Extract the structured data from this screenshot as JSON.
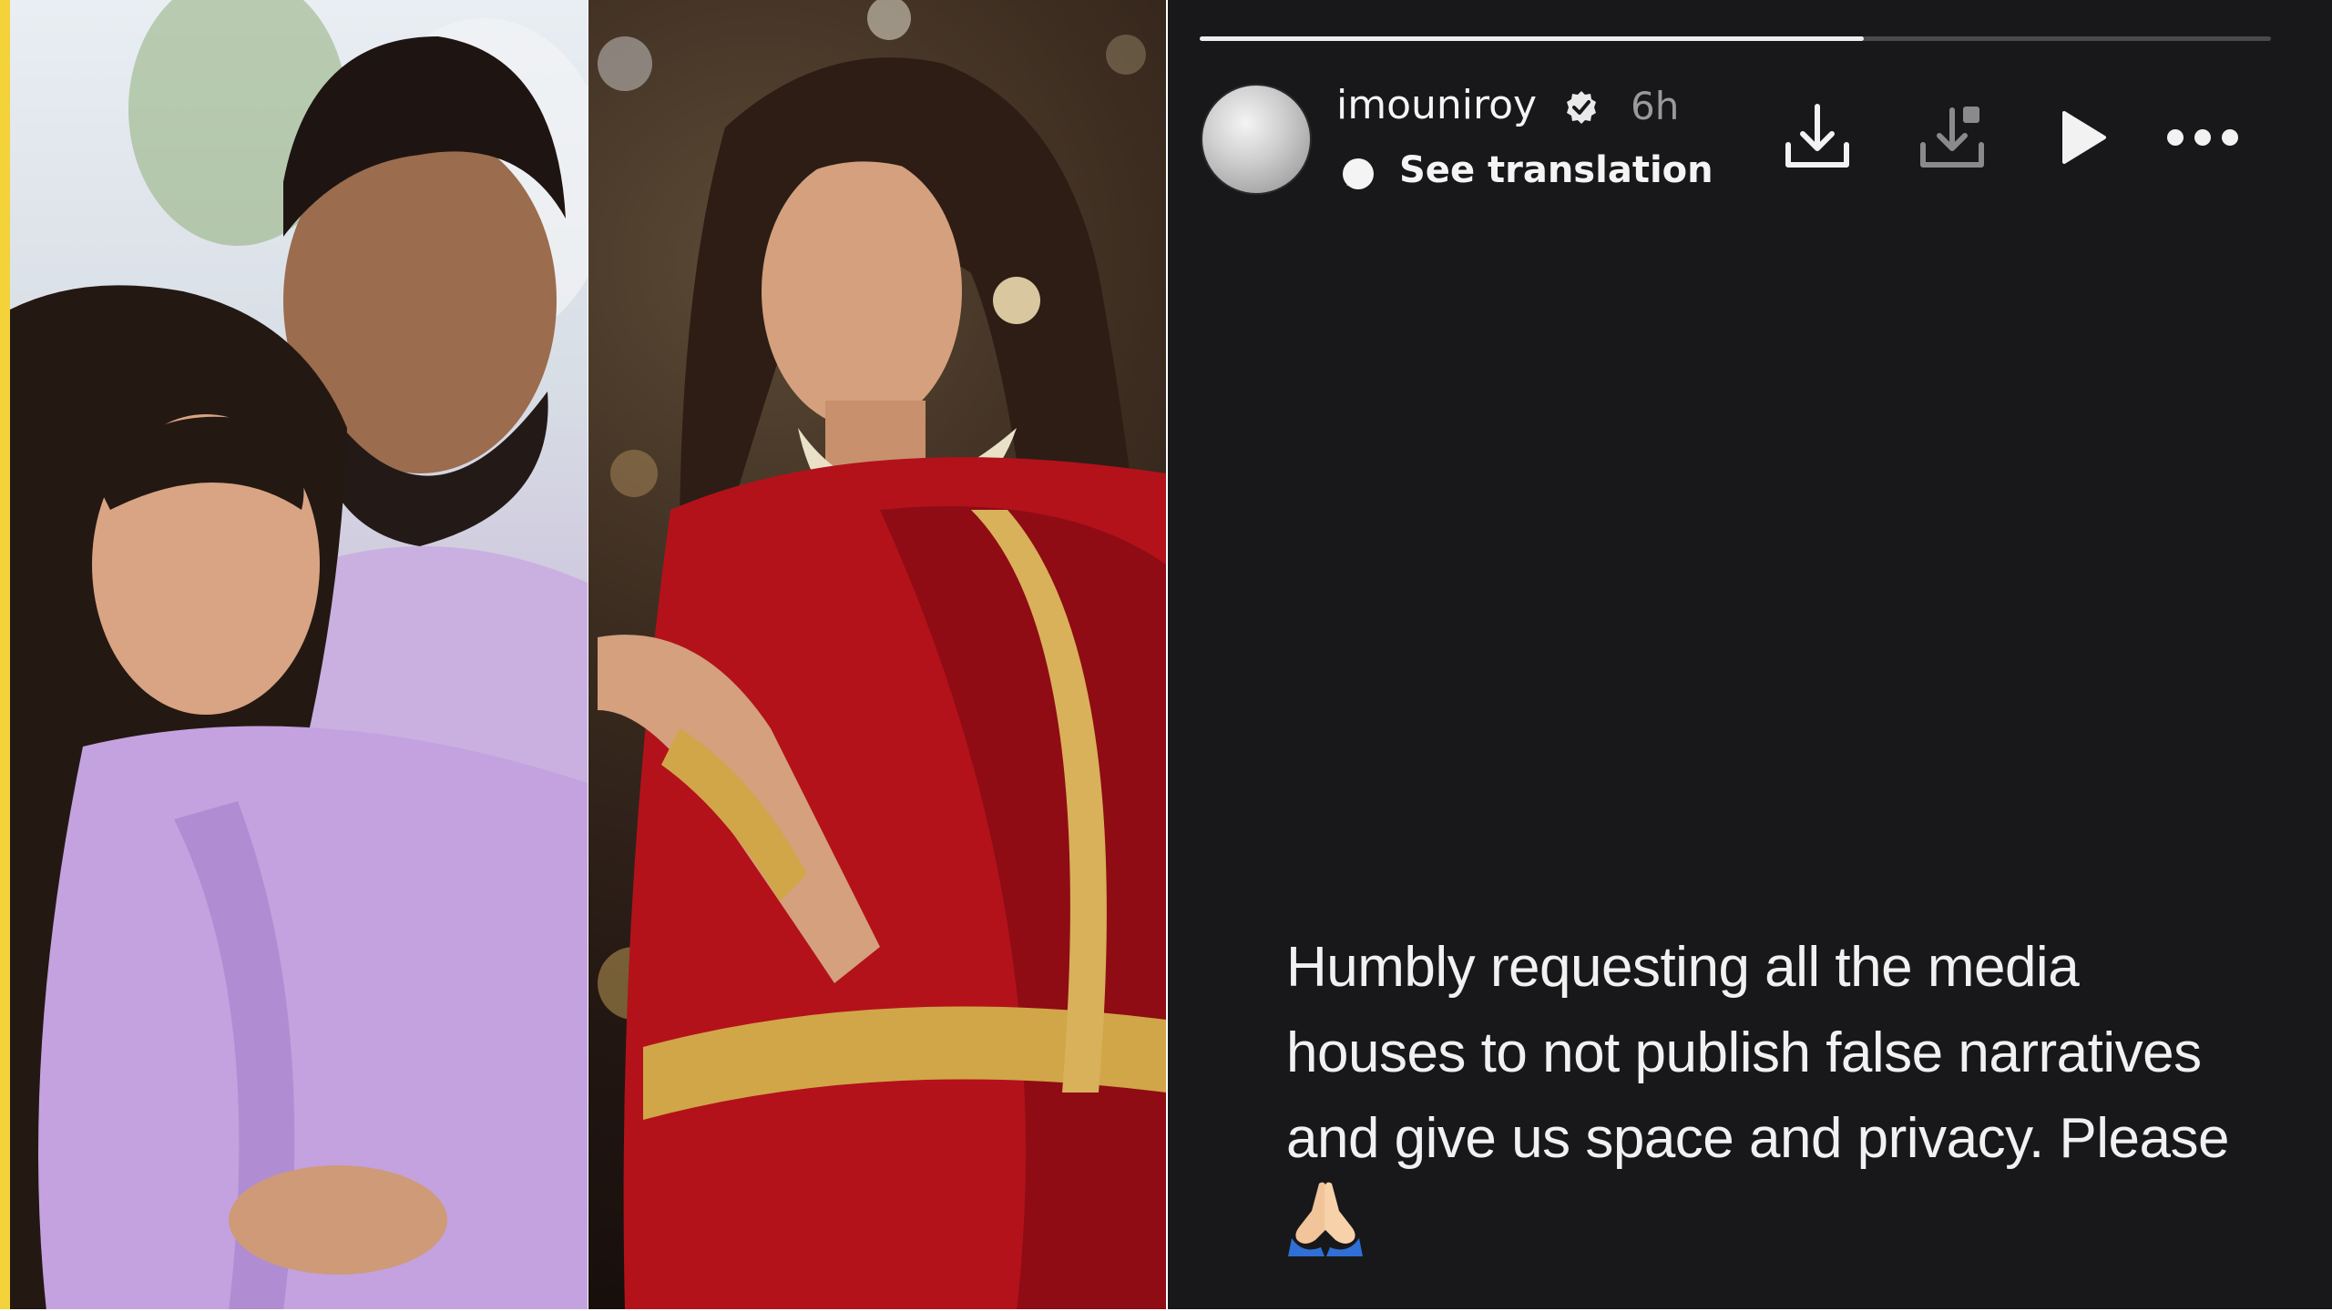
{
  "story": {
    "username": "imouniroy",
    "timestamp": "6h",
    "translation_label": "See translation",
    "text": "Humbly requesting all the media houses to not publish false narratives and give us space and privacy. Please",
    "emoji": "folded-hands",
    "progress": 0.62
  },
  "colors": {
    "background": "#18181a",
    "accent_strip": "#f3d23a"
  }
}
